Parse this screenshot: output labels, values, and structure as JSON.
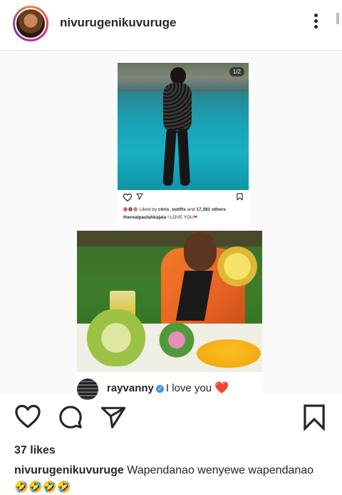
{
  "header": {
    "username": "nivurugenikuvuruge",
    "more_icon": "more-vertical-icon"
  },
  "embedded_post": {
    "counter": "1/2",
    "liked_prefix": "Liked by",
    "liked_user": "chris_outifts",
    "liked_and": "and",
    "liked_count": "17,381 others",
    "caption_user": "therealpaulahkajala",
    "caption_text": " I LOVE YOU",
    "caption_emoji": "❤"
  },
  "embedded_comment": {
    "username": "rayvanny",
    "verified_glyph": "✓",
    "text": "I love you",
    "emoji": "❤️"
  },
  "actions": {
    "like_icon": "heart-icon",
    "comment_icon": "comment-icon",
    "share_icon": "send-icon",
    "save_icon": "bookmark-icon"
  },
  "likes": "37 likes",
  "caption": {
    "username": "nivurugenikuvuruge",
    "text": " Wapendanao wenyewe wapendanao"
  },
  "caption_emojis": "🤣🤣🤣🤣"
}
